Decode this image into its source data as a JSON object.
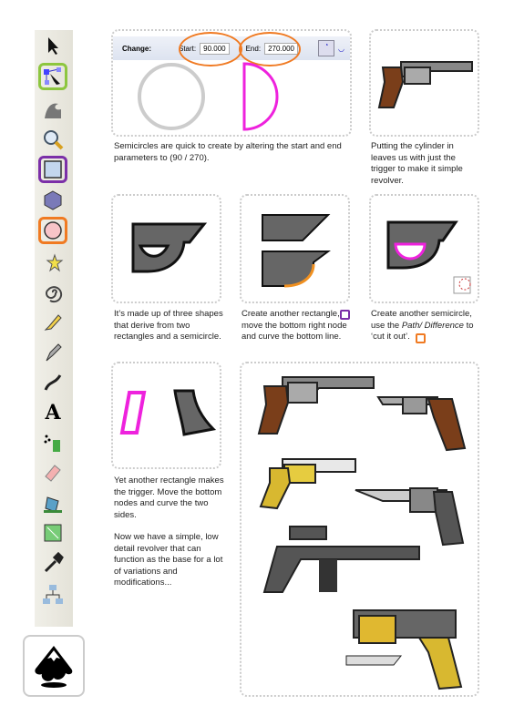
{
  "toolbar": {
    "tools": [
      "selector-tool",
      "node-tool",
      "tweak-tool",
      "zoom-tool",
      "rectangle-tool",
      "3d-box-tool",
      "ellipse-tool",
      "star-tool",
      "spiral-tool",
      "pencil-tool",
      "pen-tool",
      "calligraphy-tool",
      "text-tool",
      "spray-tool",
      "eraser-tool",
      "paint-bucket-tool",
      "gradient-tool",
      "dropper-tool",
      "connector-tool"
    ],
    "highlight_colors": {
      "node-tool": "#8dc63f",
      "rectangle-tool": "#7b2fa8",
      "ellipse-tool": "#f07a22"
    }
  },
  "arc_controls": {
    "change_label": "Change:",
    "start_label": "Start:",
    "start_value": "90.000",
    "end_label": "End:",
    "end_value": "270.000"
  },
  "captions": {
    "semicircle": "Semicircles are quick to create by altering the start and end parameters to (90 / 270).",
    "cylinder": "Putting the cylinder in leaves us with just the trigger to make it simple revolver.",
    "three_shapes": "It’s made up of three shapes that derive from two rectangles and a semicircle.",
    "rectangle": "Create another rectangle, move the bottom right node and curve the bottom line.",
    "difference_pre": "Create another semicircle, use the ",
    "difference_em": "Path/ Difference",
    "difference_post": " to ‘cut it out’.",
    "trigger": "Yet another rectangle makes the trigger. Move the bottom nodes and curve the two sides.",
    "summary": "Now we have a simple, low detail revolver that can function as the base for a lot of variations and modifications..."
  },
  "colors": {
    "gun_gray": "#666666",
    "grip_brown": "#7a3e1a",
    "accent_orange": "#f07a22",
    "accent_purple": "#7b2fa8",
    "magenta": "#ee22dd",
    "gold": "#d8b830"
  }
}
